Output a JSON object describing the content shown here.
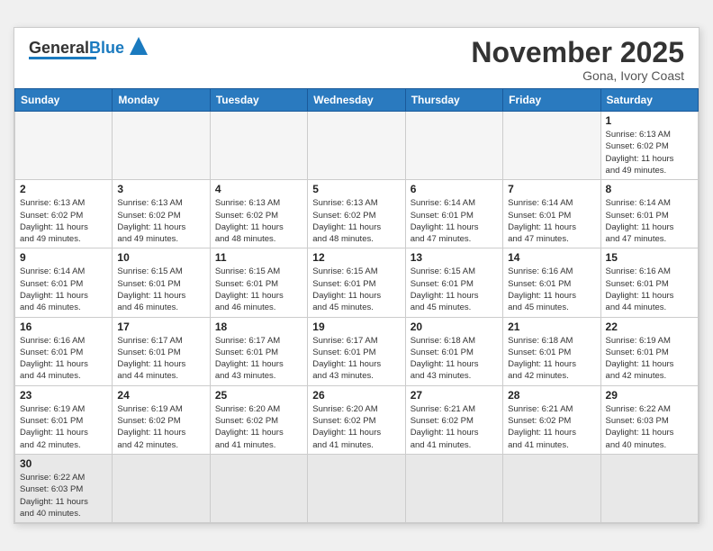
{
  "header": {
    "logo_general": "General",
    "logo_blue": "Blue",
    "month_title": "November 2025",
    "subtitle": "Gona, Ivory Coast"
  },
  "days_of_week": [
    "Sunday",
    "Monday",
    "Tuesday",
    "Wednesday",
    "Thursday",
    "Friday",
    "Saturday"
  ],
  "weeks": [
    [
      {
        "day": "",
        "info": ""
      },
      {
        "day": "",
        "info": ""
      },
      {
        "day": "",
        "info": ""
      },
      {
        "day": "",
        "info": ""
      },
      {
        "day": "",
        "info": ""
      },
      {
        "day": "",
        "info": ""
      },
      {
        "day": "1",
        "info": "Sunrise: 6:13 AM\nSunset: 6:02 PM\nDaylight: 11 hours\nand 49 minutes."
      }
    ],
    [
      {
        "day": "2",
        "info": "Sunrise: 6:13 AM\nSunset: 6:02 PM\nDaylight: 11 hours\nand 49 minutes."
      },
      {
        "day": "3",
        "info": "Sunrise: 6:13 AM\nSunset: 6:02 PM\nDaylight: 11 hours\nand 49 minutes."
      },
      {
        "day": "4",
        "info": "Sunrise: 6:13 AM\nSunset: 6:02 PM\nDaylight: 11 hours\nand 48 minutes."
      },
      {
        "day": "5",
        "info": "Sunrise: 6:13 AM\nSunset: 6:02 PM\nDaylight: 11 hours\nand 48 minutes."
      },
      {
        "day": "6",
        "info": "Sunrise: 6:14 AM\nSunset: 6:01 PM\nDaylight: 11 hours\nand 47 minutes."
      },
      {
        "day": "7",
        "info": "Sunrise: 6:14 AM\nSunset: 6:01 PM\nDaylight: 11 hours\nand 47 minutes."
      },
      {
        "day": "8",
        "info": "Sunrise: 6:14 AM\nSunset: 6:01 PM\nDaylight: 11 hours\nand 47 minutes."
      }
    ],
    [
      {
        "day": "9",
        "info": "Sunrise: 6:14 AM\nSunset: 6:01 PM\nDaylight: 11 hours\nand 46 minutes."
      },
      {
        "day": "10",
        "info": "Sunrise: 6:15 AM\nSunset: 6:01 PM\nDaylight: 11 hours\nand 46 minutes."
      },
      {
        "day": "11",
        "info": "Sunrise: 6:15 AM\nSunset: 6:01 PM\nDaylight: 11 hours\nand 46 minutes."
      },
      {
        "day": "12",
        "info": "Sunrise: 6:15 AM\nSunset: 6:01 PM\nDaylight: 11 hours\nand 45 minutes."
      },
      {
        "day": "13",
        "info": "Sunrise: 6:15 AM\nSunset: 6:01 PM\nDaylight: 11 hours\nand 45 minutes."
      },
      {
        "day": "14",
        "info": "Sunrise: 6:16 AM\nSunset: 6:01 PM\nDaylight: 11 hours\nand 45 minutes."
      },
      {
        "day": "15",
        "info": "Sunrise: 6:16 AM\nSunset: 6:01 PM\nDaylight: 11 hours\nand 44 minutes."
      }
    ],
    [
      {
        "day": "16",
        "info": "Sunrise: 6:16 AM\nSunset: 6:01 PM\nDaylight: 11 hours\nand 44 minutes."
      },
      {
        "day": "17",
        "info": "Sunrise: 6:17 AM\nSunset: 6:01 PM\nDaylight: 11 hours\nand 44 minutes."
      },
      {
        "day": "18",
        "info": "Sunrise: 6:17 AM\nSunset: 6:01 PM\nDaylight: 11 hours\nand 43 minutes."
      },
      {
        "day": "19",
        "info": "Sunrise: 6:17 AM\nSunset: 6:01 PM\nDaylight: 11 hours\nand 43 minutes."
      },
      {
        "day": "20",
        "info": "Sunrise: 6:18 AM\nSunset: 6:01 PM\nDaylight: 11 hours\nand 43 minutes."
      },
      {
        "day": "21",
        "info": "Sunrise: 6:18 AM\nSunset: 6:01 PM\nDaylight: 11 hours\nand 42 minutes."
      },
      {
        "day": "22",
        "info": "Sunrise: 6:19 AM\nSunset: 6:01 PM\nDaylight: 11 hours\nand 42 minutes."
      }
    ],
    [
      {
        "day": "23",
        "info": "Sunrise: 6:19 AM\nSunset: 6:01 PM\nDaylight: 11 hours\nand 42 minutes."
      },
      {
        "day": "24",
        "info": "Sunrise: 6:19 AM\nSunset: 6:02 PM\nDaylight: 11 hours\nand 42 minutes."
      },
      {
        "day": "25",
        "info": "Sunrise: 6:20 AM\nSunset: 6:02 PM\nDaylight: 11 hours\nand 41 minutes."
      },
      {
        "day": "26",
        "info": "Sunrise: 6:20 AM\nSunset: 6:02 PM\nDaylight: 11 hours\nand 41 minutes."
      },
      {
        "day": "27",
        "info": "Sunrise: 6:21 AM\nSunset: 6:02 PM\nDaylight: 11 hours\nand 41 minutes."
      },
      {
        "day": "28",
        "info": "Sunrise: 6:21 AM\nSunset: 6:02 PM\nDaylight: 11 hours\nand 41 minutes."
      },
      {
        "day": "29",
        "info": "Sunrise: 6:22 AM\nSunset: 6:03 PM\nDaylight: 11 hours\nand 40 minutes."
      }
    ],
    [
      {
        "day": "30",
        "info": "Sunrise: 6:22 AM\nSunset: 6:03 PM\nDaylight: 11 hours\nand 40 minutes."
      },
      {
        "day": "",
        "info": ""
      },
      {
        "day": "",
        "info": ""
      },
      {
        "day": "",
        "info": ""
      },
      {
        "day": "",
        "info": ""
      },
      {
        "day": "",
        "info": ""
      },
      {
        "day": "",
        "info": ""
      }
    ]
  ]
}
